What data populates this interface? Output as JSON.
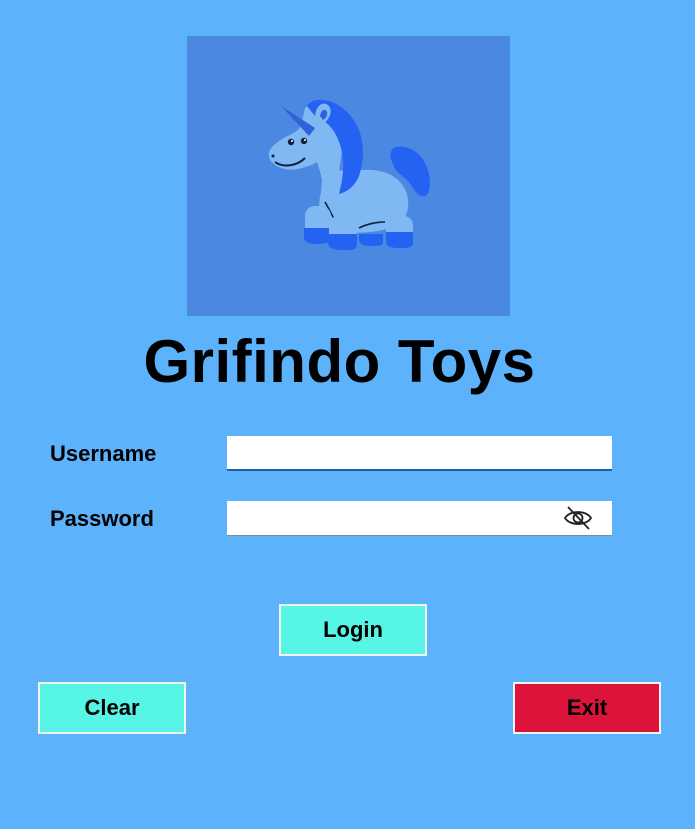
{
  "app": {
    "title": "Grifindo Toys"
  },
  "logo": {
    "icon": "unicorn-icon",
    "background_color": "#4a88e2"
  },
  "form": {
    "username_label": "Username",
    "username_value": "",
    "password_label": "Password",
    "password_value": "",
    "password_toggle_icon": "eye-slash-icon"
  },
  "buttons": {
    "login_label": "Login",
    "clear_label": "Clear",
    "exit_label": "Exit"
  },
  "colors": {
    "background": "#5cb3fb",
    "accent_button": "#57f5e6",
    "exit_button": "#dc143c"
  }
}
